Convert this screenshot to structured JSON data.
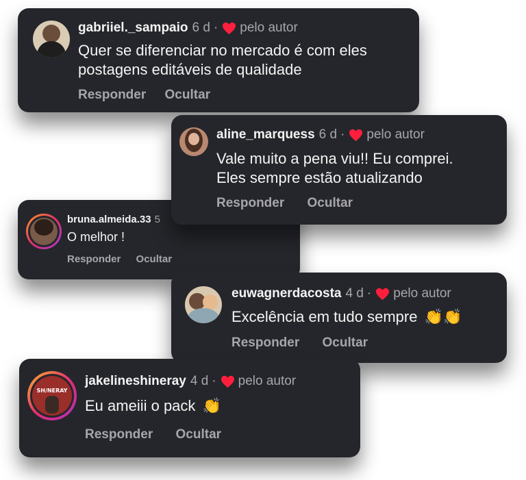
{
  "comments": [
    {
      "username": "gabriiel._sampaio",
      "age": "6 d",
      "liked_by_author": "pelo autor",
      "text_lines": [
        "Quer se diferenciar no mercado é com eles",
        "postagens editáveis de qualidade"
      ],
      "reply": "Responder",
      "hide": "Ocultar"
    },
    {
      "username": "aline_marquess",
      "age": "6 d",
      "liked_by_author": "pelo autor",
      "text_lines": [
        "Vale muito a pena viu!! Eu comprei.",
        "Eles sempre estão atualizando"
      ],
      "reply": "Responder",
      "hide": "Ocultar"
    },
    {
      "username": "bruna.almeida.33",
      "age": "5",
      "text_lines": [
        "O melhor !"
      ],
      "reply": "Responder",
      "hide": "Ocultar"
    },
    {
      "username": "euwagnerdacosta",
      "age": "4 d",
      "liked_by_author": "pelo autor",
      "text_lines": [
        "Excelência em tudo sempre"
      ],
      "reply": "Responder",
      "hide": "Ocultar"
    },
    {
      "username": "jakelineshineray",
      "age": "4 d",
      "liked_by_author": "pelo autor",
      "text_lines": [
        "Eu ameiii o pack"
      ],
      "reply": "Responder",
      "hide": "Ocultar",
      "avatar_text": "SH/NERAY"
    }
  ],
  "colors": {
    "card_bg": "#25262b",
    "heart": "#ff1f3d",
    "meta": "#a6a6ab",
    "text": "#f4f4f4"
  }
}
